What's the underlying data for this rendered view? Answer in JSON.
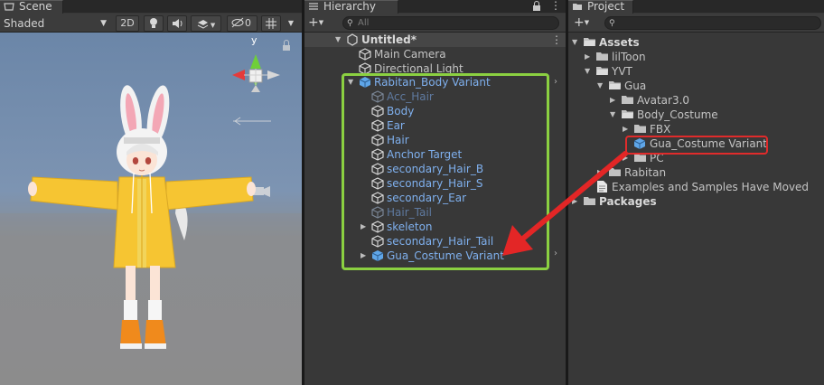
{
  "scene": {
    "tab_label": "Scene",
    "shading_mode": "Shaded",
    "mode_2d": "2D",
    "hidden_count": "0",
    "gizmo_axis_label": "y",
    "colors": {
      "sky": "#6b86a8",
      "ground": "#8d8d8d",
      "jacket": "#f6c532",
      "shoes": "#f08a1c"
    }
  },
  "hierarchy": {
    "tab_label": "Hierarchy",
    "search_placeholder": "All",
    "scene_name": "Untitled*",
    "root_items": [
      {
        "label": "Main Camera"
      },
      {
        "label": "Directional Light"
      }
    ],
    "prefab": {
      "label": "Rabitan_Body Variant",
      "children": [
        {
          "label": "Acc_Hair",
          "active": false
        },
        {
          "label": "Body",
          "active": true
        },
        {
          "label": "Ear",
          "active": true
        },
        {
          "label": "Hair",
          "active": true
        },
        {
          "label": "Anchor Target",
          "active": true
        },
        {
          "label": "secondary_Hair_B",
          "active": true
        },
        {
          "label": "secondary_Hair_S",
          "active": true
        },
        {
          "label": "secondary_Ear",
          "active": true
        },
        {
          "label": "Hair_Tail",
          "active": false
        },
        {
          "label": "skeleton",
          "active": true
        },
        {
          "label": "secondary_Hair_Tail",
          "active": true
        },
        {
          "label": "Gua_Costume Variant",
          "active": true
        }
      ]
    },
    "highlight_color": "#8bd041"
  },
  "project": {
    "tab_label": "Project",
    "tree": [
      {
        "label": "Assets",
        "bold": true
      },
      {
        "label": "lilToon"
      },
      {
        "label": "YVT"
      },
      {
        "label": "Gua"
      },
      {
        "label": "Avatar3.0"
      },
      {
        "label": "Body_Costume"
      },
      {
        "label": "FBX"
      },
      {
        "label": "Gua_Costume Variant"
      },
      {
        "label": "PC"
      },
      {
        "label": "Rabitan"
      },
      {
        "label": "Examples and Samples Have Moved"
      },
      {
        "label": "Packages",
        "bold": true
      }
    ],
    "highlight_color": "#e02b2b"
  },
  "annotation": {
    "arrow_color": "#e32626"
  }
}
